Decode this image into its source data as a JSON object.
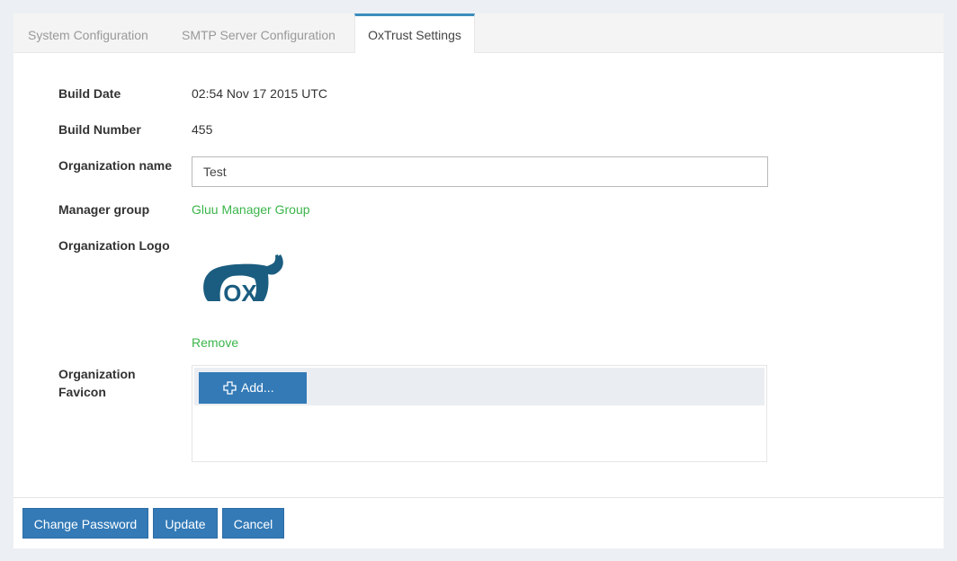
{
  "tabs": [
    {
      "label": "System Configuration",
      "active": false
    },
    {
      "label": "SMTP Server Configuration",
      "active": false
    },
    {
      "label": "OxTrust Settings",
      "active": true
    }
  ],
  "fields": {
    "build_date": {
      "label": "Build Date",
      "value": "02:54 Nov 17 2015 UTC"
    },
    "build_number": {
      "label": "Build Number",
      "value": "455"
    },
    "org_name": {
      "label": "Organization name",
      "value": "Test"
    },
    "manager_group": {
      "label": "Manager group",
      "value": "Gluu Manager Group"
    },
    "org_logo": {
      "label": "Organization Logo",
      "logo_text": "OX",
      "remove_label": "Remove"
    },
    "org_favicon": {
      "label_line1": "Organization",
      "label_line2": "Favicon",
      "add_label": "Add..."
    }
  },
  "footer": {
    "change_password": "Change Password",
    "update": "Update",
    "cancel": "Cancel"
  },
  "colors": {
    "primary": "#337ab7",
    "link": "#3bb54a",
    "logo": "#1b5d80",
    "background": "#ecf0f5"
  }
}
